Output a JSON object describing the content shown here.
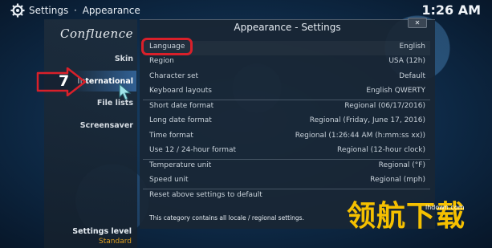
{
  "breadcrumb": {
    "settings": "Settings",
    "separator": "·",
    "section": "Appearance"
  },
  "clock": "1:26 AM",
  "sidebar": {
    "logo": "Confluence",
    "items": [
      {
        "label": "Skin"
      },
      {
        "label": "International",
        "active": true
      },
      {
        "label": "File lists"
      },
      {
        "label": "Screensaver"
      }
    ],
    "settings_level_label": "Settings level",
    "settings_level_value": "Standard"
  },
  "panel": {
    "title": "Appearance - Settings",
    "close_label": "✕",
    "rows": [
      {
        "label": "Language",
        "value": "English"
      },
      {
        "label": "Region",
        "value": "USA (12h)"
      },
      {
        "label": "Character set",
        "value": "Default"
      },
      {
        "label": "Keyboard layouts",
        "value": "English QWERTY"
      },
      {
        "label": "Short date format",
        "value": "Regional (06/17/2016)"
      },
      {
        "label": "Long date format",
        "value": "Regional (Friday, June 17, 2016)"
      },
      {
        "label": "Time format",
        "value": "Regional (1:26:44 AM (h:mm:ss xx))"
      },
      {
        "label": "Use 12 / 24-hour format",
        "value": "Regional (12-hour clock)"
      },
      {
        "label": "Temperature unit",
        "value": "Regional (°F)"
      },
      {
        "label": "Speed unit",
        "value": "Regional (mph)"
      },
      {
        "label": "Reset above settings to default",
        "value": ""
      }
    ],
    "description": "This category contains all locale / regional settings."
  },
  "annotation": {
    "step_number": "7"
  },
  "watermark": {
    "text": "领航下载",
    "url": "lhdown.com"
  },
  "colors": {
    "highlight_red": "#d9202a",
    "level_orange": "#e0a020",
    "watermark_yellow": "#f5c000"
  }
}
